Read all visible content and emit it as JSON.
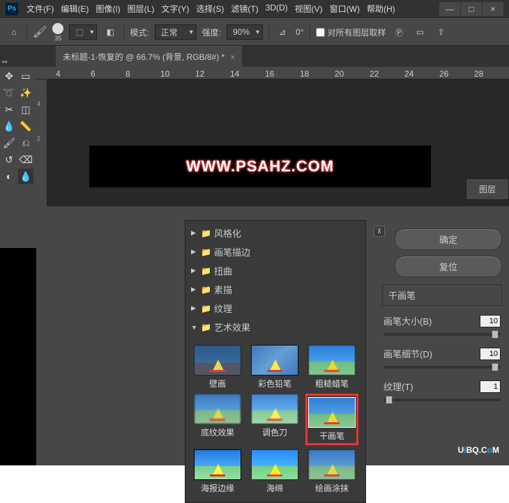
{
  "app": {
    "logo": "Ps"
  },
  "menu": {
    "file": "文件(F)",
    "edit": "编辑(E)",
    "image": "图像(I)",
    "layer": "图层(L)",
    "text": "文字(Y)",
    "select": "选择(S)",
    "filter": "滤镜(T)",
    "threeD": "3D(D)",
    "view": "视图(V)",
    "window": "窗口(W)",
    "help": "帮助(H)"
  },
  "win": {
    "min": "—",
    "max": "□",
    "close": "×"
  },
  "options": {
    "home": "⌂",
    "brush_glyph": "🖌",
    "brush_size": "35",
    "blend_glyph": "⬚",
    "grad_glyph": "◧",
    "mode_label": "模式:",
    "mode_value": "正常",
    "strength_label": "强度:",
    "strength_value": "90%",
    "angle_glyph": "⊿",
    "angle_value": "0°",
    "sample_all": "对所有图层取样",
    "pressure": "Ⓟ",
    "tablet": "▭",
    "share": "⇪"
  },
  "doc": {
    "title": "未标题-1-恢复的 @ 66.7% (背景, RGB/8#) *",
    "close": "×"
  },
  "ruler_h": [
    "4",
    "6",
    "8",
    "10",
    "12",
    "14",
    "16",
    "18",
    "20",
    "22",
    "24",
    "26",
    "28"
  ],
  "ruler_v": [
    "4",
    "2"
  ],
  "watermark": "WWW.PSAHZ.COM",
  "panels": {
    "layers": "图层"
  },
  "tree": {
    "stylize": "风格化",
    "brushstrokes": "画笔描边",
    "distort": "扭曲",
    "sketch": "素描",
    "texture": "纹理",
    "artistic": "艺术效果"
  },
  "thumbs": {
    "wall": "壁画",
    "pencil": "彩色铅笔",
    "crayon": "粗糙蜡笔",
    "texture": "底纹效果",
    "knife": "调色刀",
    "dry": "干画笔",
    "poster": "海报边缘",
    "sponge": "海绵",
    "paint": "绘画涂抹"
  },
  "buttons": {
    "ok": "确定",
    "reset": "复位"
  },
  "filter_name": "干画笔",
  "params": {
    "size_label": "画笔大小(B)",
    "size_value": "10",
    "detail_label": "画笔细节(D)",
    "detail_value": "10",
    "texture_label": "纹理(T)",
    "texture_value": "1"
  },
  "brand": {
    "u1": "U",
    "i": "i",
    "bq": "BQ.",
    "c": "C",
    "o": "o",
    "m": "M"
  }
}
